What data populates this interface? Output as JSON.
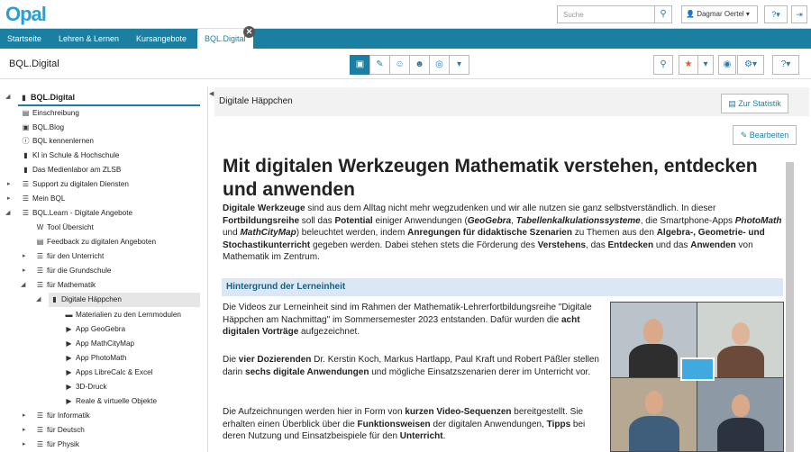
{
  "topbar": {
    "logo": "Opal",
    "search_placeholder": "Suche",
    "user_label": "Dagmar Oertel",
    "help_label": "?",
    "logout_label": "⇥"
  },
  "nav": {
    "items": [
      "Startseite",
      "Lehren & Lernen",
      "Kursangebote"
    ],
    "active_tab": "BQL.Digital",
    "close_label": "✕"
  },
  "toolbar": {
    "course_title": "BQL.Digital"
  },
  "sidebar": {
    "root": "BQL.Digital",
    "items": [
      "Einschreibung",
      "BQL.Blog",
      "BQL kennenlernen",
      "KI in Schule & Hochschule",
      "Das Medienlabor am ZLSB",
      "Support zu digitalen Diensten",
      "Mein BQL",
      "BQL.Learn - Digitale Angebote",
      "Tool Übersicht",
      "Feedback zu digitalen Angeboten",
      "für den Unterricht",
      "für die Grundschule",
      "für Mathematik",
      "Digitale Häppchen",
      "Materialien zu den Lernmodulen",
      "App GeoGebra",
      "App MathCityMap",
      "App PhotoMath",
      "Apps LibreCalc & Excel",
      "3D-Druck",
      "Reale & virtuelle Objekte",
      "für Informatik",
      "für Deutsch",
      "für Physik"
    ]
  },
  "main": {
    "header_title": "Digitale Häppchen",
    "stat_button": "Zur Statistik",
    "edit_button": "Bearbeiten",
    "heading": "Mit digitalen Werkzeugen Mathematik verstehen, entdecken und anwenden",
    "section_title": "Hintergrund der Lerneinheit"
  },
  "colors": {
    "brand": "#1a7fa0",
    "section_bg": "#dbe7f5"
  }
}
